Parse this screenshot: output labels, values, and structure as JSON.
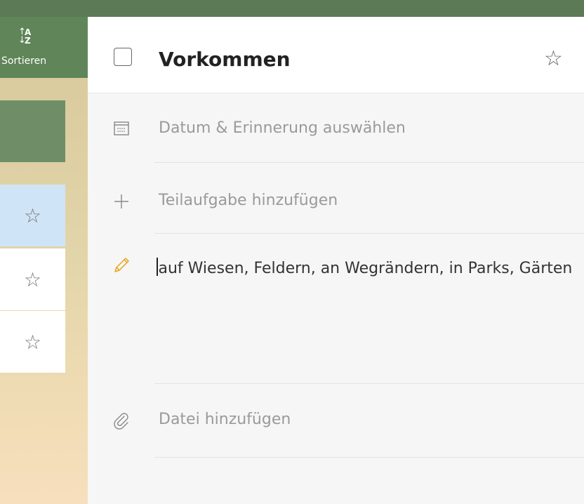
{
  "sidebar": {
    "sort_label": "Sortieren",
    "sort_letters": {
      "top": "A",
      "bottom": "Z"
    }
  },
  "task": {
    "title": "Vorkommen",
    "reminder_label": "Datum & Erinnerung auswählen",
    "subtask_label": "Teilaufgabe hinzufügen",
    "note_text": "auf Wiesen, Feldern, an Wegrändern, in Parks, Gärten",
    "file_label": "Datei hinzufügen"
  },
  "icons": {
    "sort": "sort-az-icon",
    "star": "star-outline-icon",
    "calendar": "calendar-icon",
    "plus": "plus-icon",
    "pencil": "pencil-icon",
    "paperclip": "paperclip-icon"
  },
  "colors": {
    "accent_green": "#5f8558",
    "selected_row": "#cfe5f7",
    "pencil": "#e8a317"
  }
}
